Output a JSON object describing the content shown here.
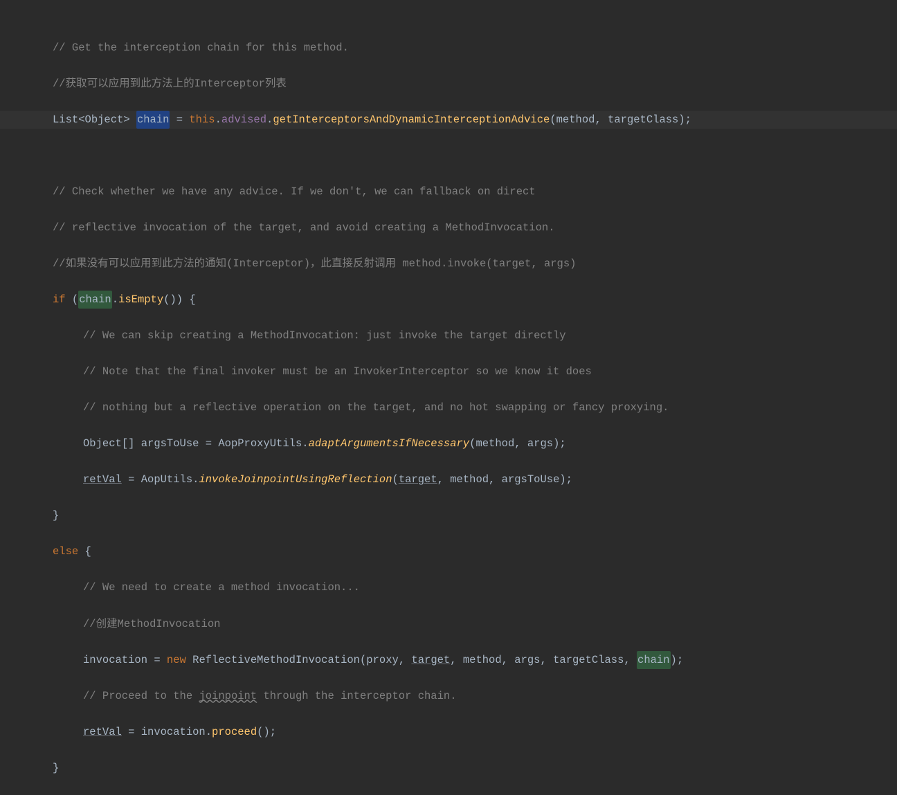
{
  "code": {
    "l1_comment": "// Get the interception chain for this method.",
    "l2_comment": "//获取可以应用到此方法上的Interceptor列表",
    "l3": {
      "type": "List",
      "gen_open": "<",
      "gen_type": "Object",
      "gen_close": "> ",
      "var_chain": "chain",
      "eq": " = ",
      "this": "this",
      "dot1": ".",
      "advised": "advised",
      "dot2": ".",
      "method": "getInterceptorsAndDynamicInterceptionAdvice",
      "open": "(",
      "a1": "method",
      "c1": ", ",
      "a2": "targetClass",
      "close": ");"
    },
    "l5_comment": "// Check whether we have any advice. If we don't, we can fallback on direct",
    "l6_comment": "// reflective invocation of the target, and avoid creating a MethodInvocation.",
    "l7_comment": "//如果没有可以应用到此方法的通知(Interceptor)，此直接反射调用 method.invoke(target, args)",
    "l8": {
      "if": "if ",
      "open": "(",
      "chain": "chain",
      "dot": ".",
      "isEmpty": "isEmpty",
      "call": "()) {"
    },
    "l9_comment": "// We can skip creating a MethodInvocation: just invoke the target directly",
    "l10_comment": "// Note that the final invoker must be an InvokerInterceptor so we know it does",
    "l11_comment": "// nothing but a reflective operation on the target, and no hot swapping or fancy proxying.",
    "l12": {
      "type": "Object",
      "arr": "[] ",
      "var": "argsToUse",
      "eq": " = ",
      "cls": "AopProxyUtils",
      "dot": ".",
      "method": "adaptArgumentsIfNecessary",
      "open": "(",
      "a1": "method",
      "c1": ", ",
      "a2": "args",
      "close": ");"
    },
    "l13": {
      "retVal": "retVal",
      "eq": " = ",
      "cls": "AopUtils",
      "dot": ".",
      "method": "invokeJoinpointUsingReflection",
      "open": "(",
      "a1": "target",
      "c1": ", ",
      "a2": "method",
      "c2": ", ",
      "a3": "argsToUse",
      "close": ");"
    },
    "l14_brace": "}",
    "l15": {
      "else": "else ",
      "brace": "{"
    },
    "l16_comment": "// We need to create a method invocation...",
    "l17_comment": "//创建MethodInvocation",
    "l18": {
      "inv": "invocation",
      "eq": " = ",
      "new": "new ",
      "cls": "ReflectiveMethodInvocation",
      "open": "(",
      "a1": "proxy",
      "c1": ", ",
      "a2": "target",
      "c2": ", ",
      "a3": "method",
      "c3": ", ",
      "a4": "args",
      "c4": ", ",
      "a5": "targetClass",
      "c5": ", ",
      "a6": "chain",
      "close": ");"
    },
    "l19_a": "// Proceed to the ",
    "l19_jp": "joinpoint",
    "l19_b": " through the interceptor chain.",
    "l20": {
      "retVal": "retVal",
      "eq": " = ",
      "inv": "invocation",
      "dot": ".",
      "method": "proceed",
      "call": "();"
    },
    "l21_brace": "}"
  }
}
